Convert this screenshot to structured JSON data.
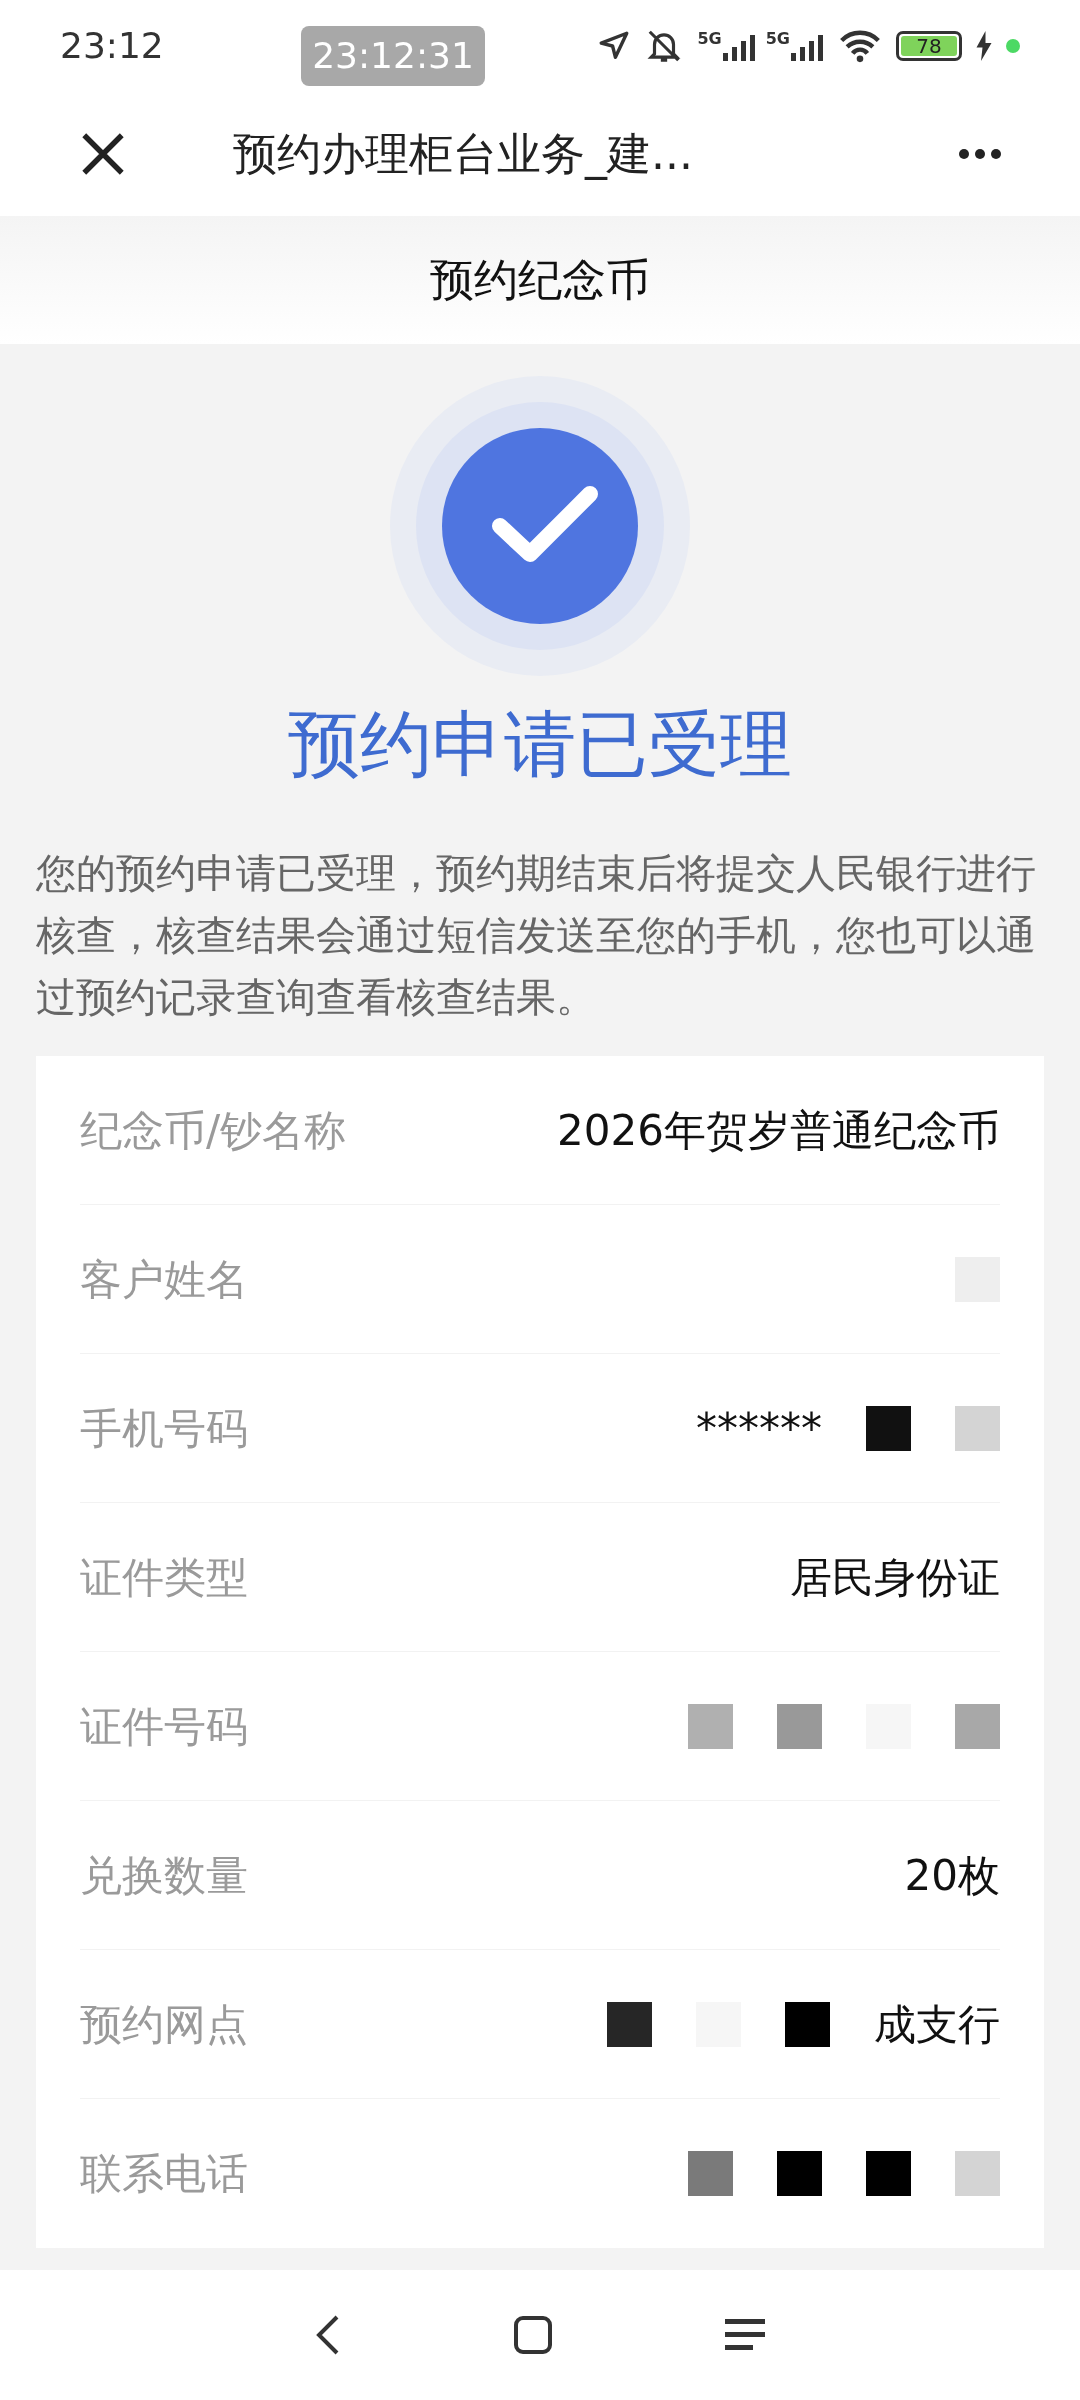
{
  "status_bar": {
    "time": "23:12",
    "recording_time": "23:12:31",
    "networks": [
      "5G",
      "5G"
    ],
    "battery": "78"
  },
  "title_bar": {
    "title": "预约办理柜台业务_建..."
  },
  "page_header": {
    "title": "预约纪念币"
  },
  "result": {
    "title": "预约申请已受理",
    "message": "您的预约申请已受理，预约期结束后将提交人民银行进行核查，核查结果会通过短信发送至您的手机，您也可以通过预约记录查询查看核查结果。"
  },
  "details": [
    {
      "label": "纪念币/钞名称",
      "value": "2026年贺岁普通纪念币"
    },
    {
      "label": "客户姓名",
      "masks": [
        {
          "color": "#eeeeee"
        }
      ]
    },
    {
      "label": "手机号码",
      "value": "******",
      "masks": [
        {
          "color": "#111111"
        },
        {
          "color": "#d4d4d4"
        }
      ]
    },
    {
      "label": "证件类型",
      "value": "居民身份证"
    },
    {
      "label": "证件号码",
      "masks": [
        {
          "color": "#b0b0b0"
        },
        {
          "color": "#999999"
        },
        {
          "color": "#f6f6f6"
        },
        {
          "color": "#a8a8a8"
        }
      ]
    },
    {
      "label": "兑换数量",
      "value": "20枚"
    },
    {
      "label": "预约网点",
      "value": "成支行",
      "value_after_masks": true,
      "masks": [
        {
          "color": "#262626"
        },
        {
          "color": "#f6f6f6"
        },
        {
          "color": "#000000"
        }
      ]
    },
    {
      "label": "联系电话",
      "masks": [
        {
          "color": "#7a7a7a"
        },
        {
          "color": "#000000"
        },
        {
          "color": "#000000"
        },
        {
          "color": "#d4d4d4"
        }
      ]
    }
  ]
}
